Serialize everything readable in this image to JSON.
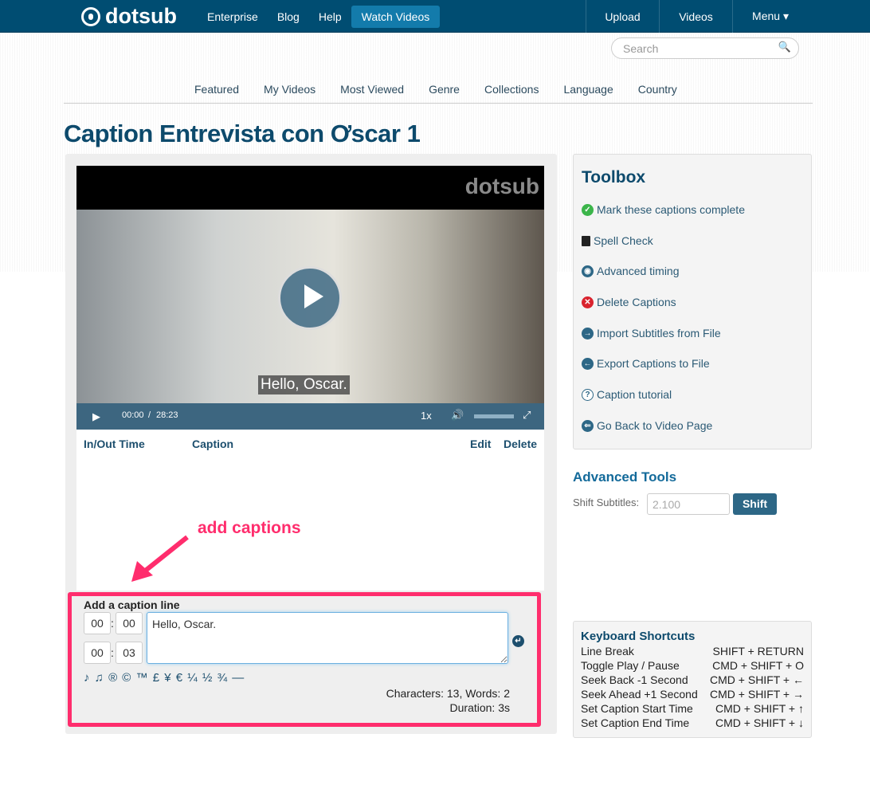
{
  "header": {
    "brand": "dotsub",
    "nav": [
      "Enterprise",
      "Blog",
      "Help",
      "Watch Videos"
    ],
    "active": "Watch Videos",
    "right_nav": [
      "Upload",
      "Videos",
      "Menu ▾"
    ]
  },
  "search": {
    "placeholder": "Search"
  },
  "subnav": [
    "Featured",
    "My Videos",
    "Most Viewed",
    "Genre",
    "Collections",
    "Language",
    "Country"
  ],
  "page_title": "Caption Entrevista con Ơscar 1",
  "video": {
    "watermark": "dotsub",
    "subtitle": "Hello, Oscar.",
    "current_time": "00:00",
    "separator": "/",
    "duration": "28:23",
    "speed": "1x"
  },
  "table": {
    "headers": {
      "time": "In/Out Time",
      "caption": "Caption",
      "edit": "Edit",
      "delete": "Delete"
    }
  },
  "annotation": "add captions",
  "add_caption": {
    "title": "Add a caption line",
    "in_min": "00",
    "in_sec": "00",
    "out_min": "00",
    "out_sec": "03",
    "colon": ":",
    "text": "Hello, Oscar.",
    "symbols": "♪ ♫ ® © ™ £ ¥ € ¼ ½ ¾ —",
    "stats": "Characters: 13, Words: 2",
    "duration": "Duration: 3s"
  },
  "toolbox": {
    "title": "Toolbox",
    "items": [
      {
        "label": "Mark these captions complete",
        "icon": "check-circle",
        "color": "#3bb54a"
      },
      {
        "label": "Spell Check",
        "icon": "book",
        "color": "#222222"
      },
      {
        "label": "Advanced timing",
        "icon": "target",
        "color": "#2d6786"
      },
      {
        "label": "Delete Captions",
        "icon": "x-circle",
        "color": "#d9232e"
      },
      {
        "label": "Import Subtitles from File",
        "icon": "import",
        "color": "#2d6786"
      },
      {
        "label": "Export Captions to File",
        "icon": "export",
        "color": "#2d6786"
      },
      {
        "label": "Caption tutorial",
        "icon": "question",
        "color": "#2d6786"
      },
      {
        "label": "Go Back to Video Page",
        "icon": "back",
        "color": "#2d6786"
      }
    ]
  },
  "advanced": {
    "title": "Advanced Tools",
    "shift_label": "Shift Subtitles:",
    "shift_placeholder": "2.100",
    "shift_button": "Shift"
  },
  "shortcuts": {
    "title": "Keyboard Shortcuts",
    "rows": [
      [
        "Line Break",
        "SHIFT + RETURN"
      ],
      [
        "Toggle Play / Pause",
        "CMD + SHIFT + O"
      ],
      [
        "Seek Back -1 Second",
        "CMD + SHIFT + ←"
      ],
      [
        "Seek Ahead +1 Second",
        "CMD + SHIFT + →"
      ],
      [
        "Set Caption Start Time",
        "CMD + SHIFT + ↑"
      ],
      [
        "Set Caption End Time",
        "CMD + SHIFT + ↓"
      ]
    ]
  }
}
